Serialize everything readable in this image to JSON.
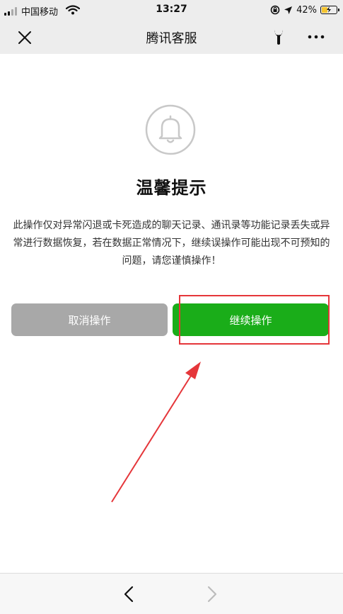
{
  "status_bar": {
    "carrier": "中国移动",
    "time": "13:27",
    "battery_percent": "42%",
    "battery_level": 0.42
  },
  "nav": {
    "title": "腾讯客服",
    "icons": [
      "close-icon",
      "wrench-icon",
      "more-icon"
    ]
  },
  "dialog": {
    "icon": "bell-icon",
    "title": "温馨提示",
    "message": "此操作仅对异常闪退或卡死造成的聊天记录、通讯录等功能记录丢失或异常进行数据恢复，若在数据正常情况下，继续误操作可能出现不可预知的问题，请您谨慎操作！",
    "cancel_label": "取消操作",
    "continue_label": "继续操作"
  },
  "annotation": {
    "color": "#e5363a"
  },
  "colors": {
    "primary_green": "#1aad19",
    "cancel_gray": "#a8a8a8",
    "nav_background": "#ededed"
  },
  "bottom_bar": {
    "icons": [
      "back-arrow-icon",
      "forward-arrow-icon"
    ]
  }
}
